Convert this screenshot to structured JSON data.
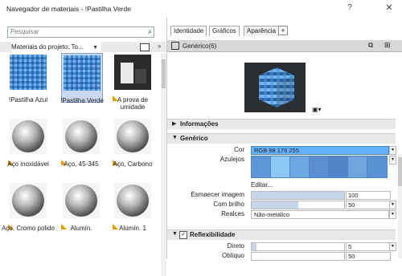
{
  "window": {
    "title": "Navegador de materiais - !Pastilha Verde",
    "help": "?",
    "close": "✕"
  },
  "left": {
    "search_placeholder": "Pesquisar",
    "library_label": "Materiais do projeto: To...",
    "chevron": "»",
    "tiles": [
      {
        "label": "!Pastilha Azul",
        "kind": "blue",
        "selected": false
      },
      {
        "label": "!Pastilha Verde",
        "kind": "blue",
        "selected": true
      },
      {
        "label": "A prova de umidade",
        "kind": "dark",
        "selected": false
      },
      {
        "label": "Aço inoxidável",
        "kind": "chrome",
        "selected": false
      },
      {
        "label": "Aço, 45-345",
        "kind": "chrome",
        "selected": false
      },
      {
        "label": "Aço, Carbono",
        "kind": "chrome",
        "selected": false
      },
      {
        "label": "Aço, Cromo polido",
        "kind": "chrome",
        "selected": false
      },
      {
        "label": "Alumín.",
        "kind": "chrome",
        "selected": false
      },
      {
        "label": "Alumín. 1",
        "kind": "chrome",
        "selected": false
      }
    ]
  },
  "right": {
    "tabs": [
      "Identidade",
      "Gráficos",
      "Aparência"
    ],
    "add_tab": "+",
    "asset_name": "Genérico(6)",
    "sections": {
      "info": "Informações",
      "generic": "Genérico",
      "reflect": "Reflexibilidade"
    },
    "props": {
      "color_label": "Cor",
      "color_value": "RGB 98 176 255",
      "tiles_label": "Azulejos",
      "edit": "Editar...",
      "fade_label": "Esmaecer imagem",
      "fade_value": "100",
      "fade_pct": 100,
      "gloss_label": "Com brilho",
      "gloss_value": "50",
      "gloss_pct": 50,
      "highlight_label": "Realces",
      "highlight_value": "Não-metálico",
      "direct_label": "Direto",
      "direct_value": "5",
      "direct_pct": 5,
      "oblique_label": "Oblíquo",
      "oblique_value": "50"
    },
    "colors": {
      "accent": "#62b0ff"
    }
  }
}
